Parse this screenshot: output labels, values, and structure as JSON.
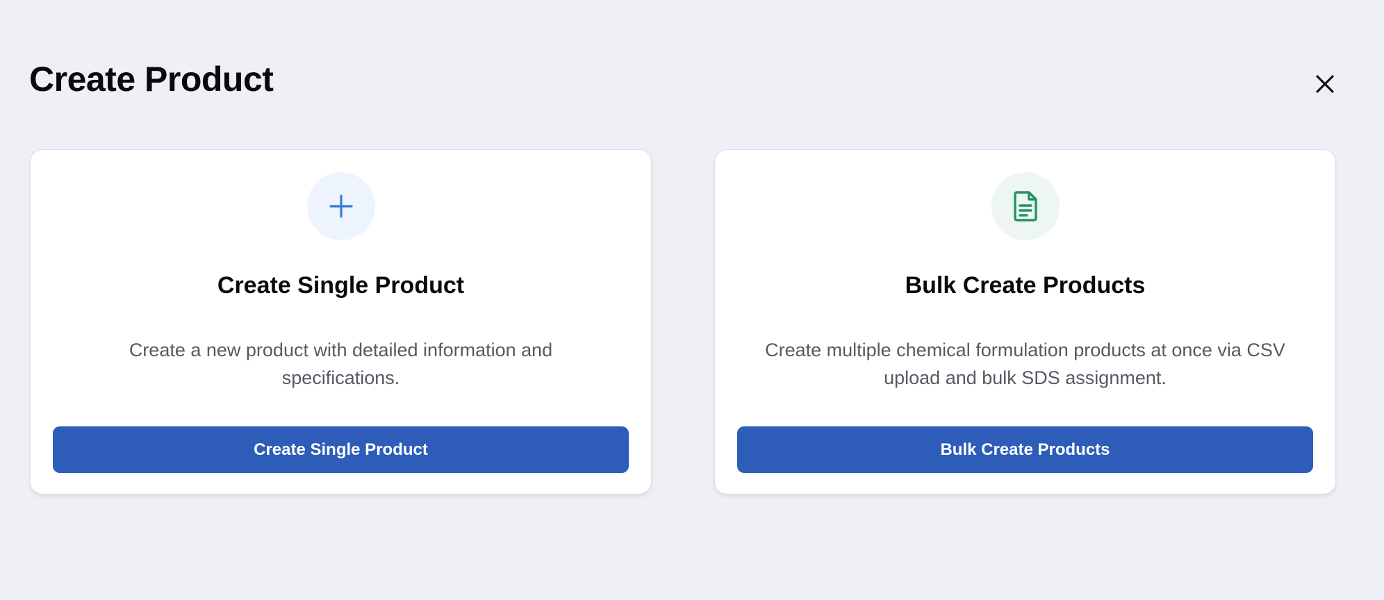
{
  "dialog": {
    "title": "Create Product",
    "close_icon": "close-icon"
  },
  "colors": {
    "background": "#eef0f5",
    "primary_button": "#2d5db9",
    "plus_icon": "#3b78d8",
    "plus_icon_bg": "#edf4fd",
    "doc_icon": "#1f9466",
    "doc_icon_bg": "#eef6f2"
  },
  "options": [
    {
      "icon": "plus-icon",
      "title": "Create Single Product",
      "description": "Create a new product with detailed information and specifications.",
      "button_label": "Create Single Product"
    },
    {
      "icon": "document-icon",
      "title": "Bulk Create Products",
      "description": "Create multiple chemical formulation products at once via CSV upload and bulk SDS assignment.",
      "button_label": "Bulk Create Products"
    }
  ]
}
